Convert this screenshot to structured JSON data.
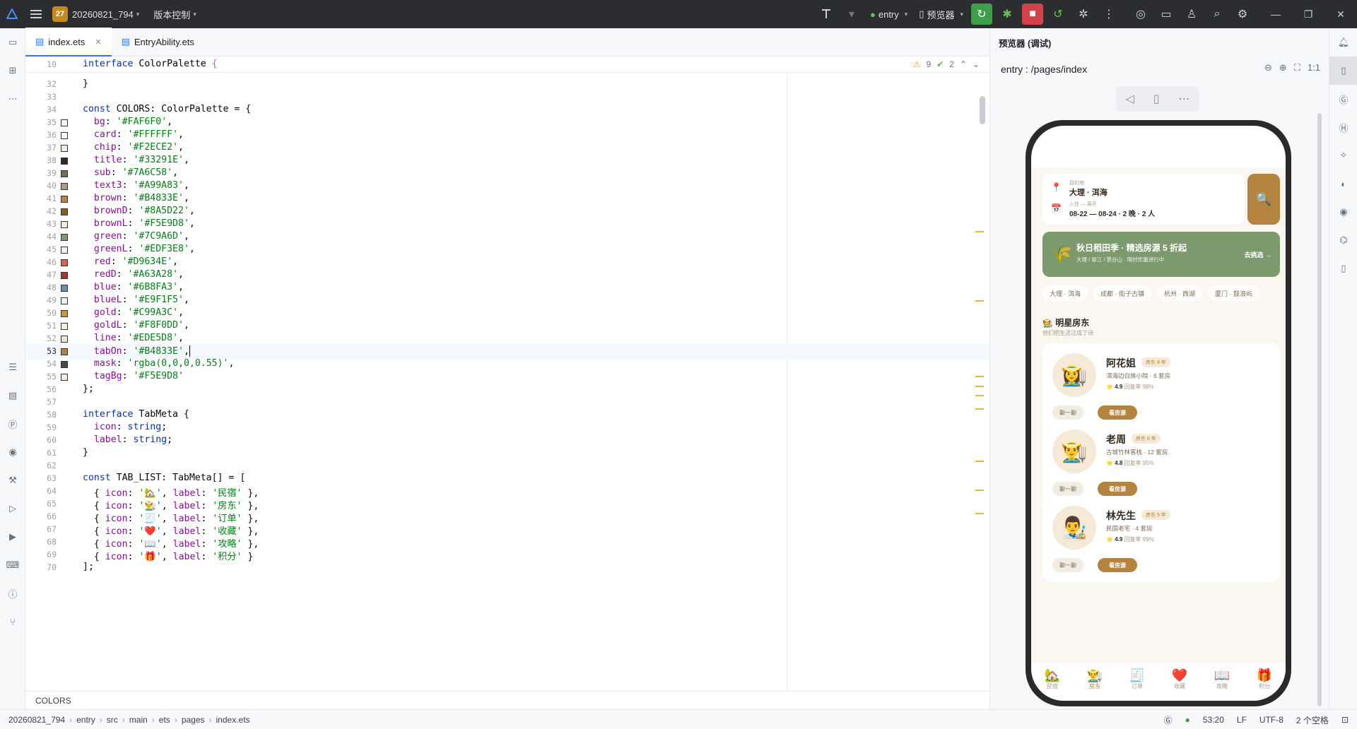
{
  "titlebar": {
    "project_badge": "27",
    "project_name": "20260821_794",
    "vcs_label": "版本控制",
    "module_select": "entry",
    "device_select": "预览器"
  },
  "tabs": [
    {
      "label": "index.ets",
      "active": true
    },
    {
      "label": "EntryAbility.ets",
      "active": false
    }
  ],
  "sticky": {
    "line": "10",
    "warnings": "9",
    "checks": "2"
  },
  "code_lines": [
    {
      "n": "32",
      "t": "}",
      "cls": "pu"
    },
    {
      "n": "33",
      "t": ""
    },
    {
      "n": "34",
      "t": "const COLORS: ColorPalette = {"
    },
    {
      "n": "35",
      "t": "  bg: '#FAF6F0',",
      "swatch": "#FAF6F0"
    },
    {
      "n": "36",
      "t": "  card: '#FFFFFF',",
      "swatch": "#FFFFFF"
    },
    {
      "n": "37",
      "t": "  chip: '#F2ECE2',",
      "swatch": "#F2ECE2"
    },
    {
      "n": "38",
      "t": "  title: '#33291E',",
      "swatch": "#33291E"
    },
    {
      "n": "39",
      "t": "  sub: '#7A6C58',",
      "swatch": "#7A6C58"
    },
    {
      "n": "40",
      "t": "  text3: '#A99A83',",
      "swatch": "#A99A83"
    },
    {
      "n": "41",
      "t": "  brown: '#B4833E',",
      "swatch": "#B4833E"
    },
    {
      "n": "42",
      "t": "  brownD: '#8A5D22',",
      "swatch": "#8A5D22"
    },
    {
      "n": "43",
      "t": "  brownL: '#F5E9D8',",
      "swatch": "#F5E9D8"
    },
    {
      "n": "44",
      "t": "  green: '#7C9A6D',",
      "swatch": "#7C9A6D"
    },
    {
      "n": "45",
      "t": "  greenL: '#EDF3E8',",
      "swatch": "#EDF3E8"
    },
    {
      "n": "46",
      "t": "  red: '#D9634E',",
      "swatch": "#D9634E"
    },
    {
      "n": "47",
      "t": "  redD: '#A63A28',",
      "swatch": "#A63A28"
    },
    {
      "n": "48",
      "t": "  blue: '#6B8FA3',",
      "swatch": "#6B8FA3"
    },
    {
      "n": "49",
      "t": "  blueL: '#E9F1F5',",
      "swatch": "#E9F1F5"
    },
    {
      "n": "50",
      "t": "  gold: '#C99A3C',",
      "swatch": "#C99A3C"
    },
    {
      "n": "51",
      "t": "  goldL: '#F8F0DD',",
      "swatch": "#F8F0DD"
    },
    {
      "n": "52",
      "t": "  line: '#EDE5D8',",
      "swatch": "#EDE5D8"
    },
    {
      "n": "53",
      "t": "  tabOn: '#B4833E',",
      "swatch": "#B4833E",
      "current": true
    },
    {
      "n": "54",
      "t": "  mask: 'rgba(0,0,0,0.55)',",
      "swatch": "#4a4a4a"
    },
    {
      "n": "55",
      "t": "  tagBg: '#F5E9D8'",
      "swatch": "#F5E9D8"
    },
    {
      "n": "56",
      "t": "};"
    },
    {
      "n": "57",
      "t": ""
    },
    {
      "n": "58",
      "t": "interface TabMeta {"
    },
    {
      "n": "59",
      "t": "  icon: string;"
    },
    {
      "n": "60",
      "t": "  label: string;"
    },
    {
      "n": "61",
      "t": "}"
    },
    {
      "n": "62",
      "t": ""
    },
    {
      "n": "63",
      "t": "const TAB_LIST: TabMeta[] = ["
    },
    {
      "n": "64",
      "t": "  { icon: '🏡', label: '民宿' },"
    },
    {
      "n": "65",
      "t": "  { icon: '👨‍🌾', label: '房东' },"
    },
    {
      "n": "66",
      "t": "  { icon: '🧾', label: '订单' },"
    },
    {
      "n": "67",
      "t": "  { icon: '❤️', label: '收藏' },"
    },
    {
      "n": "68",
      "t": "  { icon: '📖', label: '攻略' },"
    },
    {
      "n": "69",
      "t": "  { icon: '🎁', label: '积分' }"
    },
    {
      "n": "70",
      "t": "];"
    }
  ],
  "sticky_code": "interface ColorPalette {",
  "breadcrumb_editor": "COLORS",
  "preview": {
    "title": "预览器 (调试)",
    "path": "entry : /pages/index",
    "zoom": "1:1",
    "app": {
      "dest_label": "目的地",
      "dest_value": "大理 · 洱海",
      "date_label": "入住 — 离开",
      "date_value": "08-22 — 08-24 · 2 晚 · 2 人",
      "banner_title": "秋日稻田季 · 精选房源 5 折起",
      "banner_sub": "大理 / 丽江 / 景谷山 · 限时优惠进行中",
      "banner_action": "去挑选 →",
      "chips": [
        "大理 · 洱海",
        "成都 · 街子古镇",
        "杭州 · 西湖",
        "厦门 · 鼓浪屿"
      ],
      "section_title": "明星房东",
      "section_sub": "他们把生活过成了诗",
      "hosts": [
        {
          "avatar": "👩‍🌾",
          "name": "阿花姐",
          "tag": "房东 8 年",
          "desc": "洱海边白族小院 · 6 套房",
          "rating": "4.9",
          "reply": "回复率 98%"
        },
        {
          "avatar": "👨‍🌾",
          "name": "老周",
          "tag": "房东 6 年",
          "desc": "古城竹林客栈 · 12 套房",
          "rating": "4.8",
          "reply": "回复率 95%"
        },
        {
          "avatar": "👨‍🎨",
          "name": "林先生",
          "tag": "房东 5 年",
          "desc": "民国老宅 · 4 套房",
          "rating": "4.9",
          "reply": "回复率 99%"
        }
      ],
      "btn_chat": "聊一聊",
      "btn_look": "看房源",
      "tabbar": [
        {
          "icon": "🏡",
          "label": "民宿"
        },
        {
          "icon": "👨‍🌾",
          "label": "房东"
        },
        {
          "icon": "🧾",
          "label": "订单"
        },
        {
          "icon": "❤️",
          "label": "收藏"
        },
        {
          "icon": "📖",
          "label": "攻略"
        },
        {
          "icon": "🎁",
          "label": "积分"
        }
      ]
    }
  },
  "statusbar": {
    "crumbs": [
      "20260821_794",
      "entry",
      "src",
      "main",
      "ets",
      "pages",
      "index.ets"
    ],
    "position": "53:20",
    "line_sep": "LF",
    "encoding": "UTF-8",
    "indent": "2 个空格"
  }
}
